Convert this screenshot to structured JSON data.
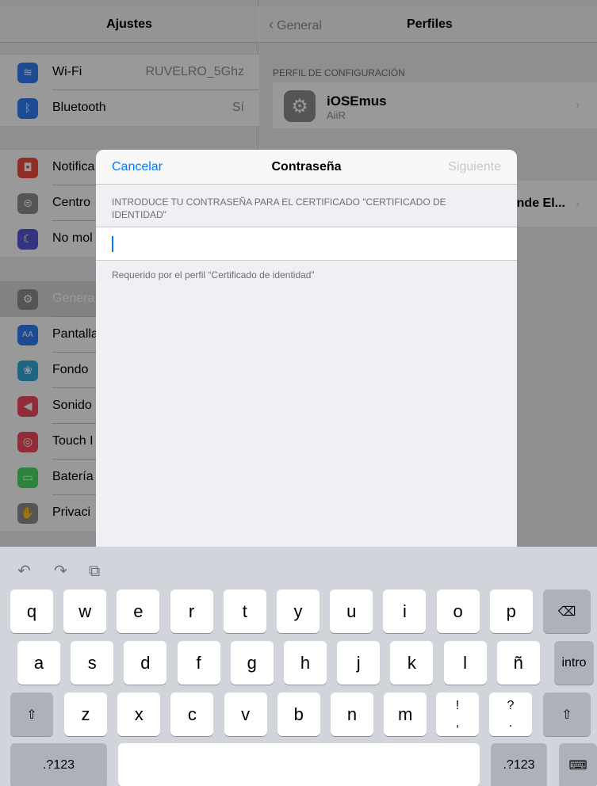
{
  "settings": {
    "title": "Ajustes",
    "rows": [
      {
        "label": "Wi-Fi",
        "value": "RUVELRO_5Ghz",
        "icon": "wifi-icon",
        "color": "#2f7cf6",
        "glyph": "≋"
      },
      {
        "label": "Bluetooth",
        "value": "Sí",
        "icon": "bluetooth-icon",
        "color": "#2f7cf6",
        "glyph": "ᛒ"
      },
      {
        "label": "Notifica",
        "icon": "notifications-icon",
        "color": "#f04c3e",
        "glyph": "◘"
      },
      {
        "label": "Centro",
        "icon": "control-center-icon",
        "color": "#8e8e93",
        "glyph": "⊜"
      },
      {
        "label": "No mol",
        "icon": "do-not-disturb-icon",
        "color": "#5856d6",
        "glyph": "☾"
      },
      {
        "label": "Genera",
        "icon": "general-gear-icon",
        "color": "#8e8e93",
        "glyph": "⚙"
      },
      {
        "label": "Pantalla",
        "icon": "display-icon",
        "color": "#2f7cf6",
        "glyph": "AA"
      },
      {
        "label": "Fondo",
        "icon": "wallpaper-icon",
        "color": "#34aadc",
        "glyph": "❀"
      },
      {
        "label": "Sonido",
        "icon": "sounds-icon",
        "color": "#f04c5e",
        "glyph": "◀"
      },
      {
        "label": "Touch I",
        "icon": "touch-id-icon",
        "color": "#f04c5e",
        "glyph": "◎"
      },
      {
        "label": "Batería",
        "icon": "battery-icon",
        "color": "#4cd964",
        "glyph": "▭"
      },
      {
        "label": "Privaci",
        "icon": "privacy-hand-icon",
        "color": "#8e8e93",
        "glyph": "✋"
      }
    ]
  },
  "profiles": {
    "back_label": "General",
    "title": "Perfiles",
    "section_label": "PERFIL DE CONFIGURACIÓN",
    "profile_name": "iOSEmus",
    "profile_sub": "AiiR",
    "second_profile": "nde El..."
  },
  "modal": {
    "cancel": "Cancelar",
    "title": "Contraseña",
    "next": "Siguiente",
    "prompt": "INTRODUCE TU CONTRASEÑA PARA EL CERTIFICADO \"CERTIFICADO DE IDENTIDAD\"",
    "password_value": "",
    "footnote": "Requerido por el perfil “Certificado de identidad”"
  },
  "keyboard": {
    "row1": [
      "q",
      "w",
      "e",
      "r",
      "t",
      "y",
      "u",
      "i",
      "o",
      "p"
    ],
    "row2": [
      "a",
      "s",
      "d",
      "f",
      "g",
      "h",
      "j",
      "k",
      "l",
      "ñ"
    ],
    "row3": [
      "z",
      "x",
      "c",
      "v",
      "b",
      "n",
      "m"
    ],
    "punct1": "!\n,",
    "punct2": "?\n.",
    "return_label": "intro",
    "numbers_label": ".?123",
    "undo_icon": "undo-icon",
    "redo_icon": "redo-icon",
    "paste_icon": "paste-icon"
  },
  "colors": {
    "accent": "#007aff",
    "disabled": "#c7c7cc"
  }
}
